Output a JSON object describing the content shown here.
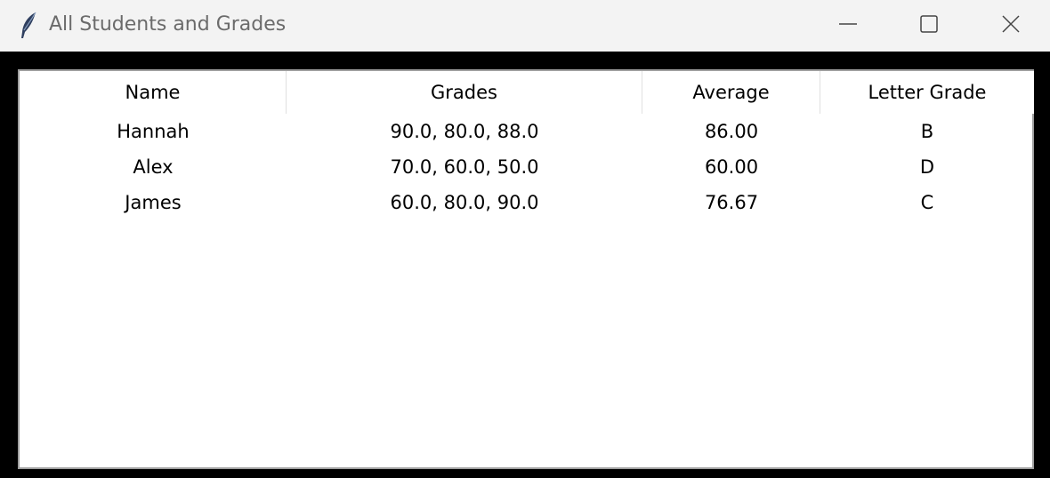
{
  "window": {
    "title": "All Students and Grades",
    "icon": "feather-icon"
  },
  "controls": {
    "minimize_icon": "minimize-icon",
    "maximize_icon": "maximize-icon",
    "close_icon": "close-icon"
  },
  "table": {
    "columns": [
      "Name",
      "Grades",
      "Average",
      "Letter Grade"
    ],
    "rows": [
      [
        "Hannah",
        "90.0, 80.0, 88.0",
        "86.00",
        "B"
      ],
      [
        "Alex",
        "70.0, 60.0, 50.0",
        "60.00",
        "D"
      ],
      [
        "James",
        "60.0, 80.0, 90.0",
        "76.67",
        "C"
      ]
    ]
  },
  "colors": {
    "titlebar": "#f3f3f3",
    "window_border": "#000000",
    "table_background": "#ffffff"
  }
}
